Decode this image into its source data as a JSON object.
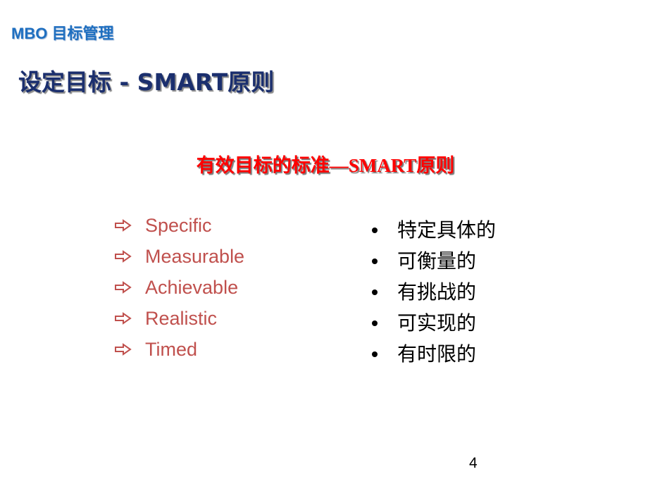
{
  "header": {
    "brand": "MBO 目标管理",
    "title": "设定目标 - SMART原则"
  },
  "content": {
    "subtitle": "有效目标的标准—SMART原则",
    "english_items": [
      {
        "icon": "hollow-right-arrow-icon",
        "label": "Specific"
      },
      {
        "icon": "hollow-right-arrow-icon",
        "label": "Measurable"
      },
      {
        "icon": "hollow-right-arrow-icon",
        "label": "Achievable"
      },
      {
        "icon": "hollow-right-arrow-icon",
        "label": "Realistic"
      },
      {
        "icon": "hollow-right-arrow-icon",
        "label": "Timed"
      }
    ],
    "chinese_items": [
      {
        "icon": "bullet-dot-icon",
        "label": "特定具体的"
      },
      {
        "icon": "bullet-dot-icon",
        "label": "可衡量的"
      },
      {
        "icon": "bullet-dot-icon",
        "label": "有挑战的"
      },
      {
        "icon": "bullet-dot-icon",
        "label": "可实现的"
      },
      {
        "icon": "bullet-dot-icon",
        "label": "有时限的"
      }
    ]
  },
  "footer": {
    "page_number": "4"
  },
  "colors": {
    "brand": "#1f6fc0",
    "title": "#1b2f6e",
    "subtitle": "#ff0000",
    "english_items": "#c0504d",
    "chinese_items": "#000000"
  }
}
